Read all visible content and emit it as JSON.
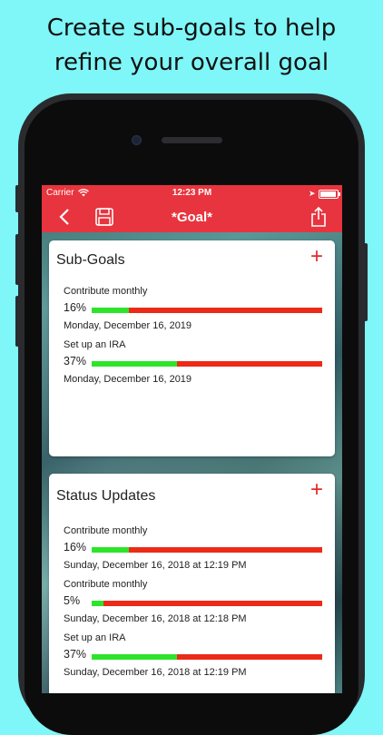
{
  "headline": {
    "line1": "Create sub-goals to help",
    "line2": "refine your overall goal"
  },
  "status_bar": {
    "carrier": "Carrier",
    "time": "12:23 PM"
  },
  "nav": {
    "title": "*Goal*"
  },
  "subgoals": {
    "title": "Sub-Goals",
    "items": [
      {
        "name": "Contribute monthly",
        "percent_label": "16%",
        "progress": 0.16,
        "date": "Monday, December 16, 2019"
      },
      {
        "name": "Set up an IRA",
        "percent_label": "37%",
        "progress": 0.37,
        "date": "Monday, December 16, 2019"
      }
    ]
  },
  "status_updates": {
    "title": "Status Updates",
    "items": [
      {
        "name": "Contribute monthly",
        "percent_label": "16%",
        "progress": 0.16,
        "date": "Sunday, December 16, 2018 at 12:19 PM"
      },
      {
        "name": "Contribute monthly",
        "percent_label": "5%",
        "progress": 0.05,
        "date": "Sunday, December 16, 2018 at 12:18 PM"
      },
      {
        "name": "Set up an IRA",
        "percent_label": "37%",
        "progress": 0.37,
        "date": "Sunday, December 16, 2018 at 12:19 PM"
      }
    ]
  },
  "colors": {
    "accent": "#e8343e",
    "progress_done": "#2ee42a",
    "progress_remaining": "#ec2a18",
    "backdrop": "#7ff6f8"
  },
  "icons": {
    "back": "chevron-left-icon",
    "save": "floppy-disk-icon",
    "share": "share-icon",
    "add": "plus-icon"
  }
}
